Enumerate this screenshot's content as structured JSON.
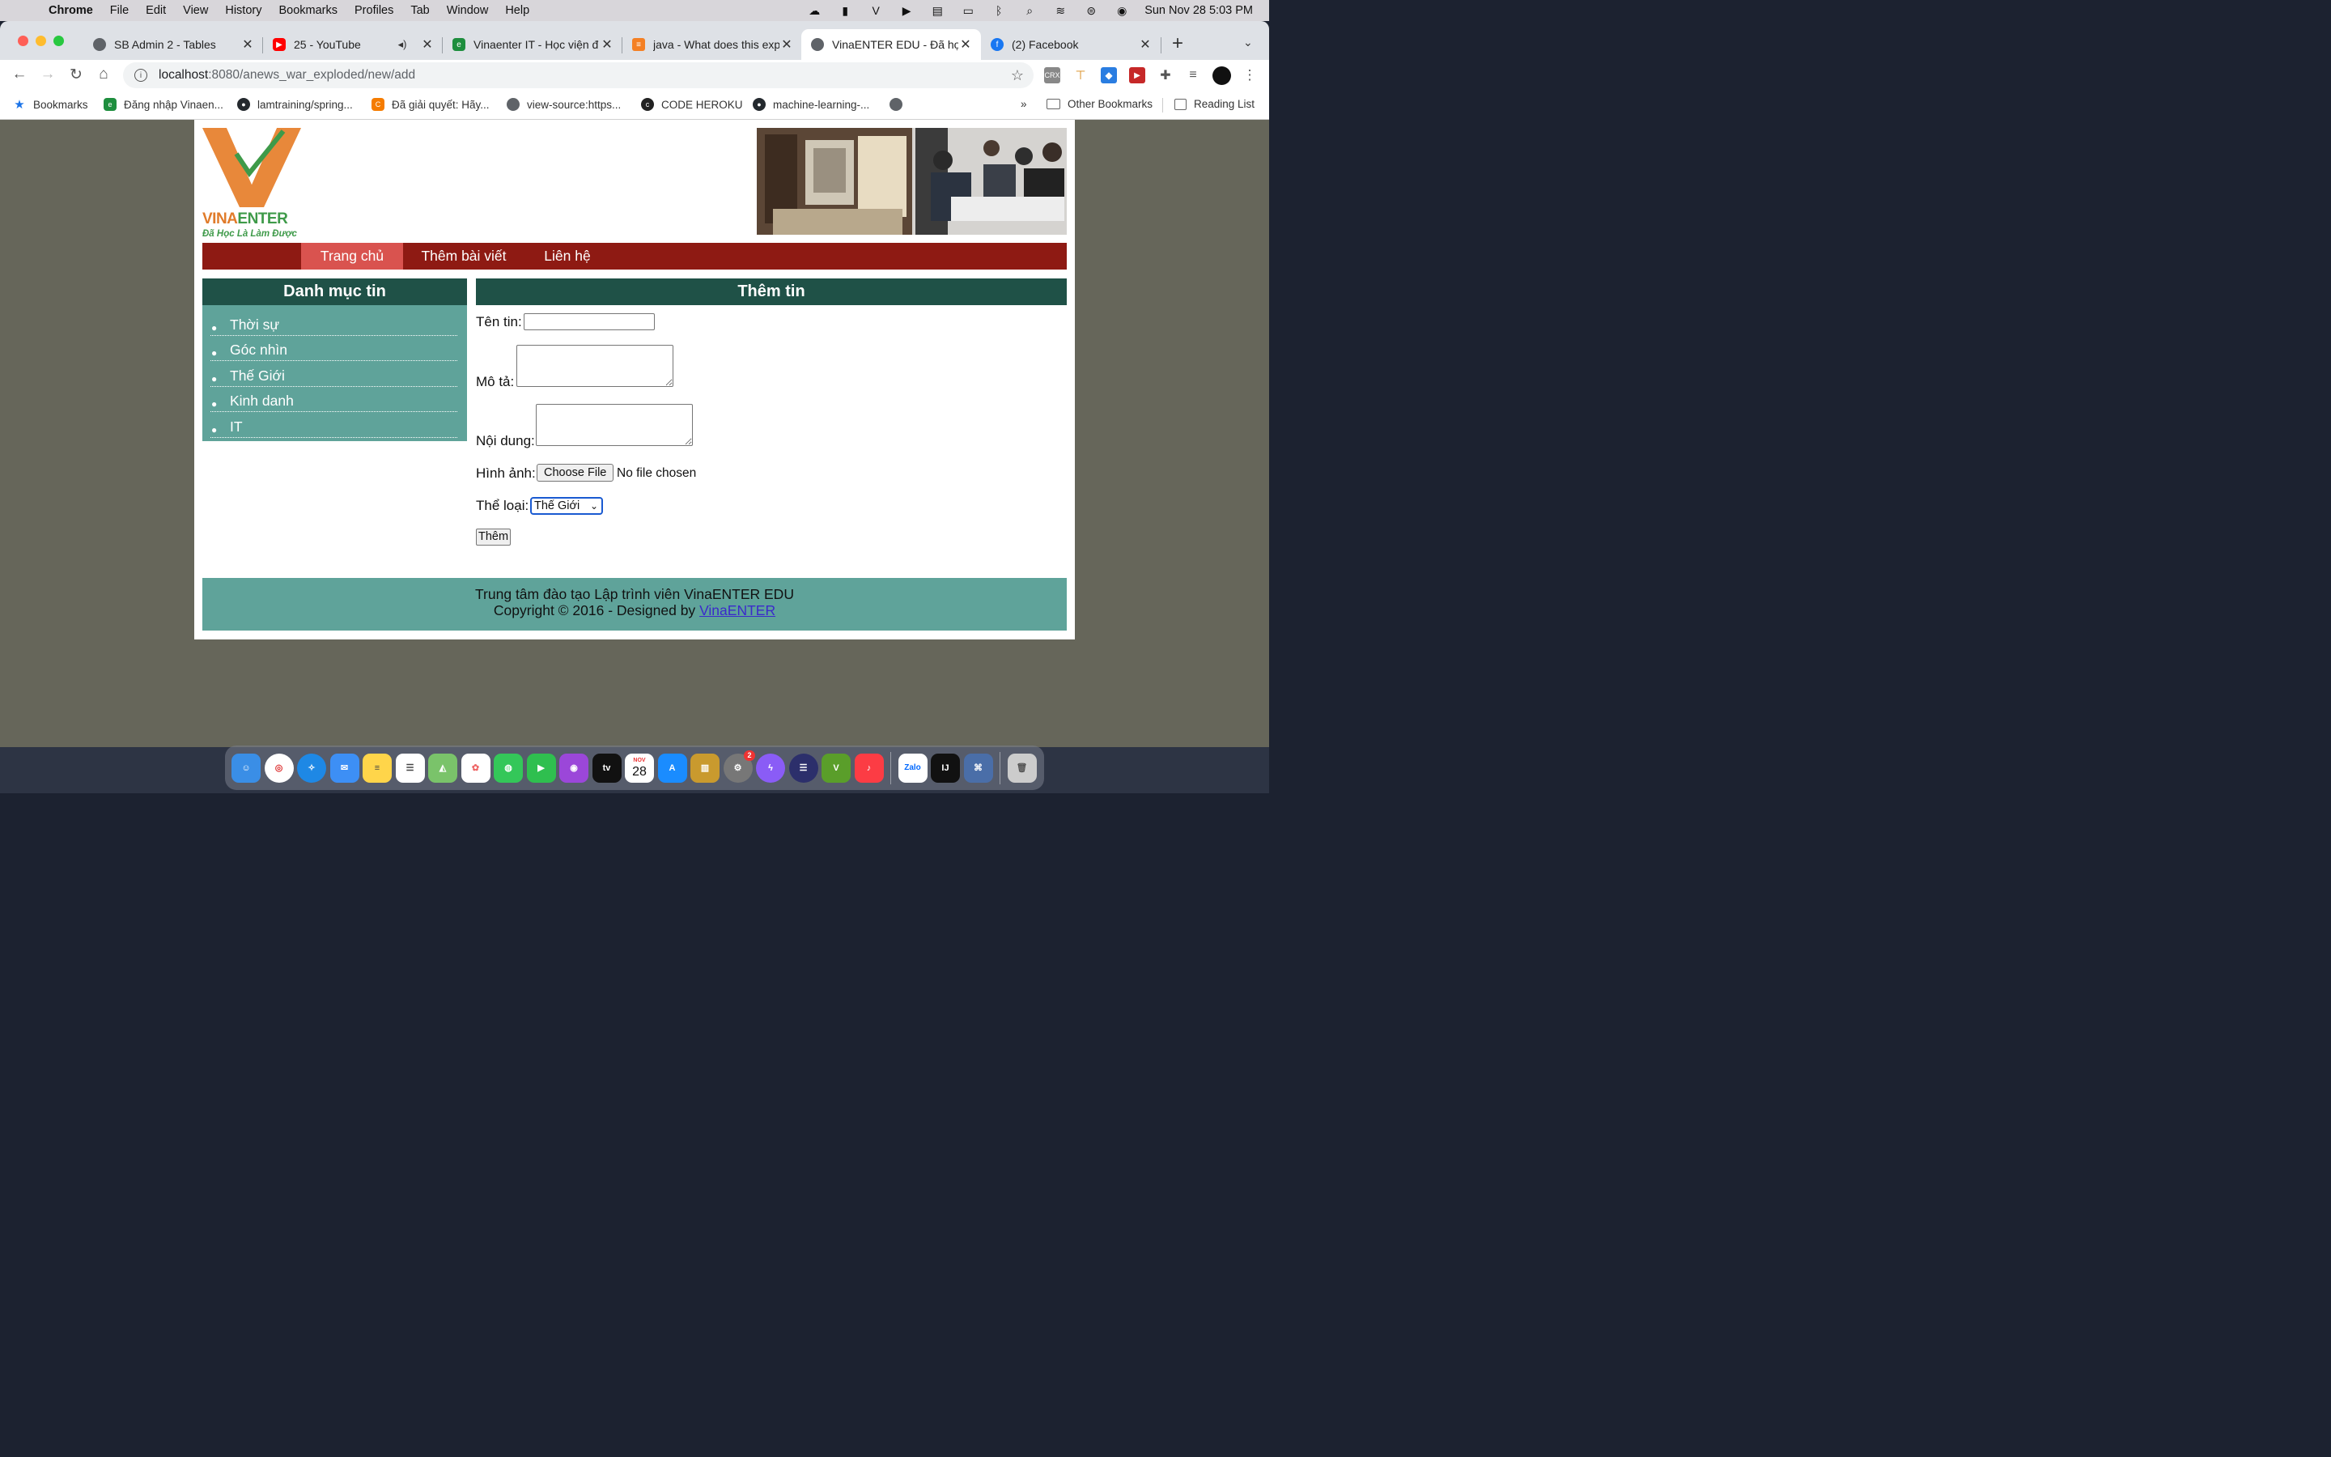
{
  "menubar": {
    "app": "Chrome",
    "items": [
      "File",
      "Edit",
      "View",
      "History",
      "Bookmarks",
      "Profiles",
      "Tab",
      "Window",
      "Help"
    ],
    "datetime": "Sun Nov 28  5:03 PM"
  },
  "tabs": [
    {
      "title": "SB Admin 2 - Tables",
      "icon": "globe-icon"
    },
    {
      "title": "25 - YouTube",
      "icon": "youtube-icon"
    },
    {
      "title": "Vinaenter IT - Học viện đ",
      "icon": "vinaenter-icon"
    },
    {
      "title": "java - What does this exp",
      "icon": "stackoverflow-icon"
    },
    {
      "title": "VinaENTER EDU - Đã học",
      "icon": "globe-icon"
    },
    {
      "title": "(2) Facebook",
      "icon": "facebook-icon"
    }
  ],
  "address": {
    "host": "localhost",
    "path": ":8080/anews_war_exploded/new/add"
  },
  "bookmarks": {
    "items": [
      "Bookmarks",
      "Đăng nhập Vinaen...",
      "lamtraining/spring...",
      "Đã giải quyết: Hãy...",
      "view-source:https...",
      "CODE HEROKU",
      "machine-learning-..."
    ],
    "overflow": "»",
    "other": "Other Bookmarks",
    "reading": "Reading List"
  },
  "site": {
    "logo_vina": "VINA",
    "logo_enter": "ENTER",
    "logo_slogan": "Đã Học Là Làm Được",
    "nav": [
      "Trang chủ",
      "Thêm bài viết",
      "Liên hệ"
    ],
    "sidebar_title": "Danh mục tin",
    "categories": [
      "Thời sự",
      "Góc nhìn",
      "Thế Giới",
      "Kinh danh",
      "IT"
    ],
    "form_title": "Thêm tin",
    "form": {
      "name_label": "Tên tin:",
      "desc_label": "Mô tả:",
      "content_label": "Nội dung:",
      "image_label": "Hình ảnh:",
      "choose_file": "Choose File",
      "no_file": "No file chosen",
      "category_label": "Thể loại:",
      "category_selected": "Thế Giới",
      "submit": "Thêm"
    },
    "footer_line1": "Trung tâm đào tạo Lập trình viên VinaENTER EDU",
    "footer_line2_prefix": "Copyright © 2016 - Designed by ",
    "footer_link": "VinaENTER"
  },
  "dock": {
    "calendar_month": "NOV",
    "calendar_day": "28",
    "settings_badge": "2"
  }
}
